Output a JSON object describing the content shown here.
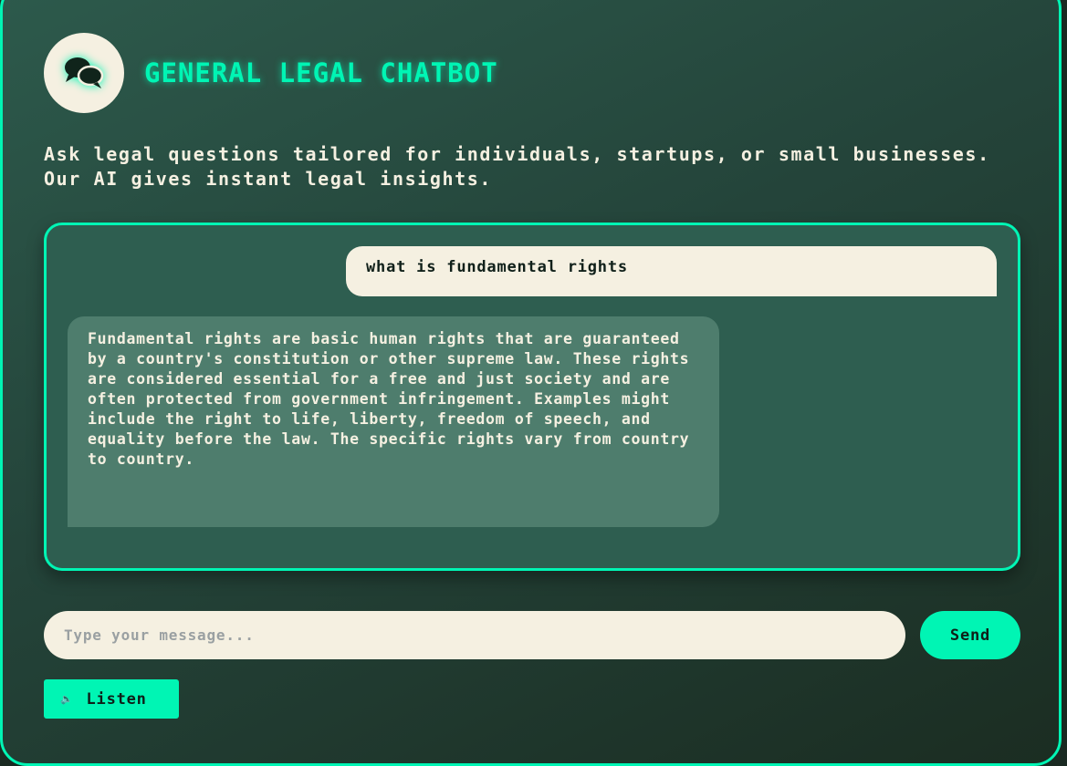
{
  "header": {
    "title": "General Legal Chatbot",
    "icon": "chat-bubbles-icon"
  },
  "subtitle": "Ask legal questions tailored for individuals, startups, or small businesses. Our AI gives instant legal insights.",
  "chat": {
    "messages": [
      {
        "role": "user",
        "text": "what is fundamental rights"
      },
      {
        "role": "bot",
        "text": "Fundamental rights are basic human rights that are guaranteed by a country's constitution or other supreme law. These rights are considered essential for a free and just society and are often protected from government infringement. Examples might include the right to life, liberty, freedom of speech, and equality before the law. The specific rights vary from country to country."
      }
    ]
  },
  "composer": {
    "placeholder": "Type your message...",
    "value": "",
    "send_label": "Send",
    "listen_label": "Listen",
    "listen_icon": "speaker-icon",
    "listen_glyph": "🔈"
  },
  "colors": {
    "accent": "#00f5b4",
    "cream": "#f5f0e1",
    "chat_bg": "#2e5e50",
    "bot_bubble": "#4e7d6d"
  }
}
